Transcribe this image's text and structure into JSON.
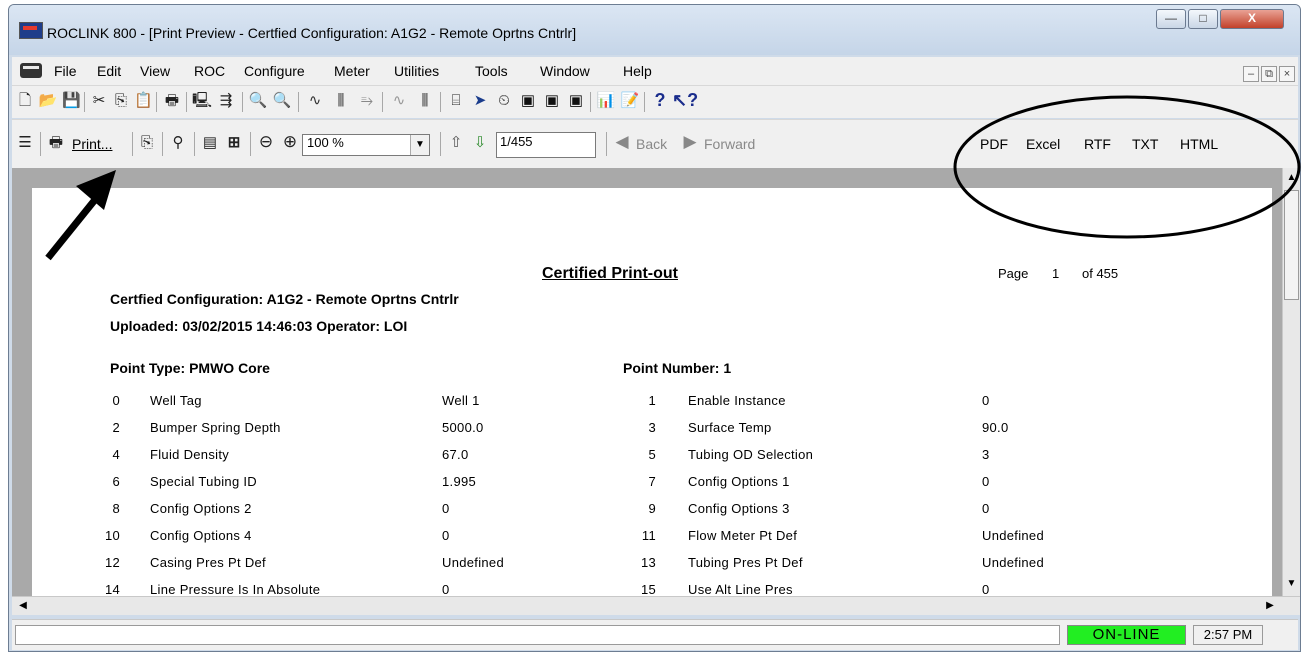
{
  "window": {
    "title": "ROCLINK 800 - [Print Preview - Certfied Configuration: A1G2 - Remote Oprtns Cntrlr]",
    "controls": {
      "minimize": "—",
      "maximize": "□",
      "close": "X"
    }
  },
  "menubar": {
    "items": [
      "File",
      "Edit",
      "View",
      "ROC",
      "Configure",
      "Meter",
      "Utilities",
      "Tools",
      "Window",
      "Help"
    ]
  },
  "toolbar2": {
    "print_label": "Print...",
    "zoom_value": "100 %",
    "page_value": "1/455",
    "back_label": "Back",
    "forward_label": "Forward",
    "export": [
      "PDF",
      "Excel",
      "RTF",
      "TXT",
      "HTML"
    ]
  },
  "report": {
    "heading": "Certified Print-out",
    "page_label": "Page",
    "page_num": "1",
    "of_label": "of 455",
    "config_line": "Certfied Configuration: A1G2 - Remote Oprtns Cntrlr",
    "upload_line": "Uploaded: 03/02/2015 14:46:03 Operator: LOI",
    "point_type": "Point Type:  PMWO Core",
    "point_number": "Point Number: 1",
    "rows": [
      {
        "ln": "0",
        "lname": "Well Tag",
        "lval": "Well 1",
        "rn": "1",
        "rname": "Enable Instance",
        "rval": "0"
      },
      {
        "ln": "2",
        "lname": "Bumper Spring Depth",
        "lval": "5000.0",
        "rn": "3",
        "rname": "Surface Temp",
        "rval": "90.0"
      },
      {
        "ln": "4",
        "lname": "Fluid Density",
        "lval": "67.0",
        "rn": "5",
        "rname": "Tubing OD Selection",
        "rval": "3"
      },
      {
        "ln": "6",
        "lname": "Special Tubing ID",
        "lval": "1.995",
        "rn": "7",
        "rname": "Config Options 1",
        "rval": "0"
      },
      {
        "ln": "8",
        "lname": "Config Options 2",
        "lval": "0",
        "rn": "9",
        "rname": "Config Options 3",
        "rval": "0"
      },
      {
        "ln": "10",
        "lname": "Config Options 4",
        "lval": "0",
        "rn": "11",
        "rname": "Flow Meter Pt Def",
        "rval": "Undefined"
      },
      {
        "ln": "12",
        "lname": "Casing Pres Pt Def",
        "lval": "Undefined",
        "rn": "13",
        "rname": "Tubing Pres Pt Def",
        "rval": "Undefined"
      },
      {
        "ln": "14",
        "lname": "Line Pressure Is In Absolute",
        "lval": "0",
        "rn": "15",
        "rname": "Use Alt Line Pres",
        "rval": "0"
      }
    ]
  },
  "status": {
    "online": "ON-LINE",
    "time": "2:57 PM"
  },
  "colors": {
    "online_bg": "#22ee22",
    "title_bar": "#cfdbe9"
  }
}
